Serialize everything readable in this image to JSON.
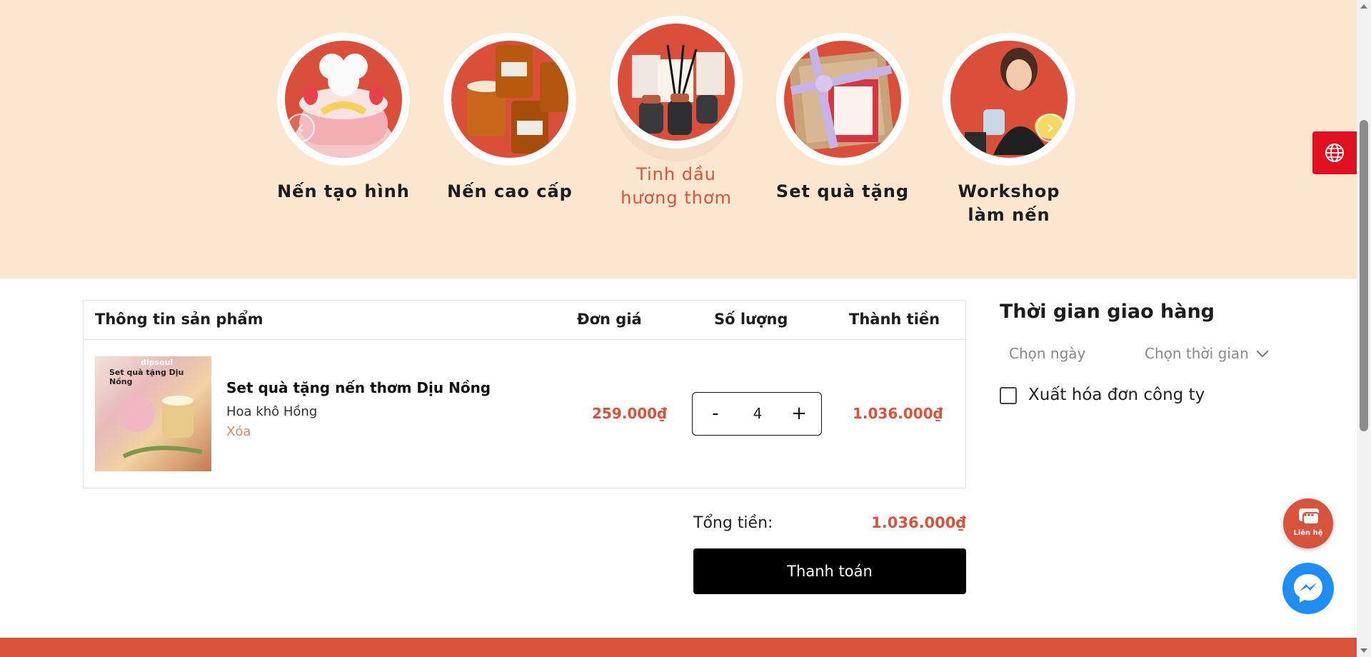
{
  "categories": [
    {
      "label": "Nến tạo hình",
      "active": false
    },
    {
      "label": "Nến cao cấp",
      "active": false
    },
    {
      "label": "Tinh dầu hương thơm",
      "active": true
    },
    {
      "label": "Set quà tặng",
      "active": false
    },
    {
      "label": "Workshop làm nến",
      "active": false
    }
  ],
  "cart": {
    "headers": {
      "product_info": "Thông tin sản phẩm",
      "unit_price": "Đơn giá",
      "quantity": "Số lượng",
      "subtotal": "Thành tiền"
    },
    "item": {
      "thumb_caption": "Set quà tặng Dịu Nồng",
      "thumb_brand": "dipsoul",
      "name": "Set quà tặng nến thơm Dịu Nồng",
      "variant": "Hoa khô Hồng",
      "remove": "Xóa",
      "unit_price": "259.000₫",
      "qty_minus": "-",
      "quantity": "4",
      "qty_plus": "+",
      "subtotal": "1.036.000₫"
    },
    "total_label": "Tổng tiền:",
    "total_value": "1.036.000₫",
    "checkout_label": "Thanh toán"
  },
  "delivery": {
    "title": "Thời gian giao hàng",
    "date_placeholder": "Chọn ngày",
    "time_placeholder": "Chọn thời gian",
    "invoice_label": "Xuất hóa đơn công ty",
    "invoice_checked": false
  },
  "floating": {
    "contact_label": "Liên hệ"
  },
  "colors": {
    "accent": "#d9533c",
    "band": "#fde6cf",
    "lang_button": "#e0101e",
    "messenger": "#1f8df5"
  }
}
